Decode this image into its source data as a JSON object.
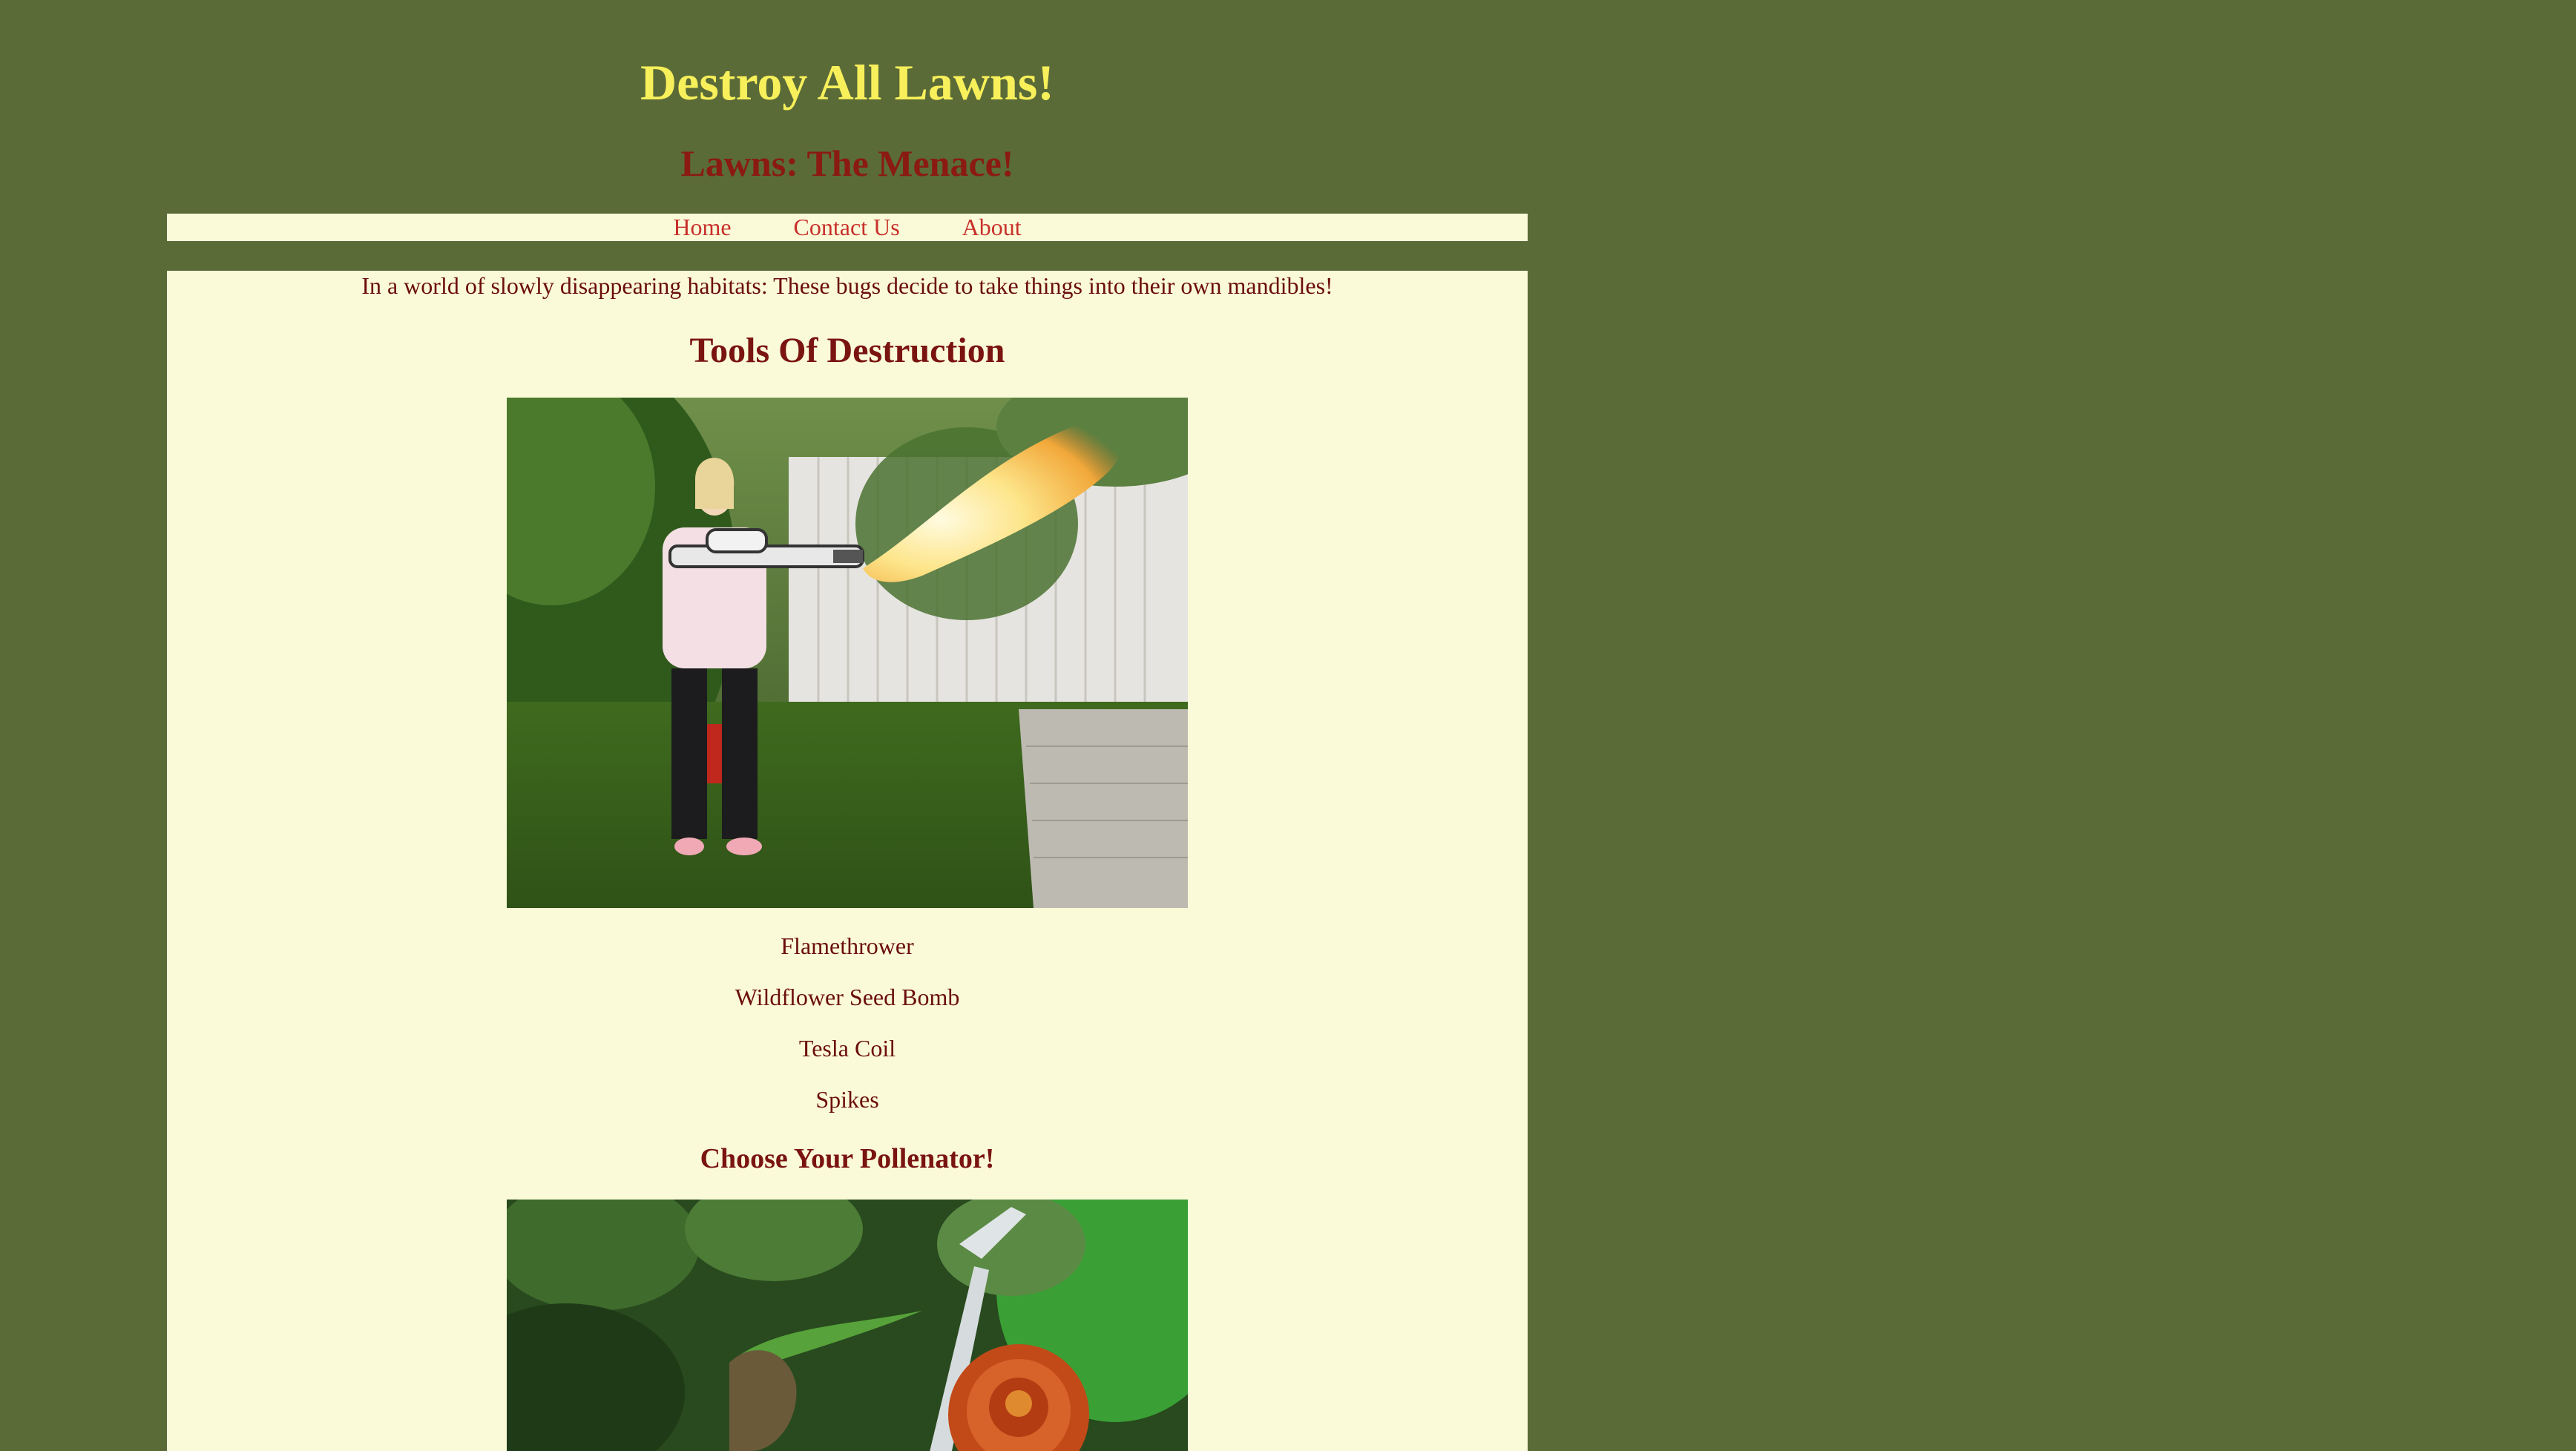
{
  "header": {
    "title": "Destroy All Lawns!",
    "subtitle": "Lawns: The Menace!"
  },
  "nav": {
    "items": [
      {
        "label": "Home"
      },
      {
        "label": "Contact Us"
      },
      {
        "label": "About"
      }
    ]
  },
  "main": {
    "intro": "In a world of slowly disappearing habitats: These bugs decide to take things into their own mandibles!",
    "tools_heading": "Tools Of Destruction",
    "tools": [
      {
        "label": "Flamethrower"
      },
      {
        "label": "Wildflower Seed Bomb"
      },
      {
        "label": "Tesla Coil"
      },
      {
        "label": "Spikes"
      }
    ],
    "pollenator_heading": "Choose Your Pollenator!"
  },
  "colors": {
    "page_background": "#5a6b38",
    "content_background": "#fafad9",
    "title": "#f8f05a",
    "heading": "#7a1410",
    "nav_link": "#c8302a"
  }
}
